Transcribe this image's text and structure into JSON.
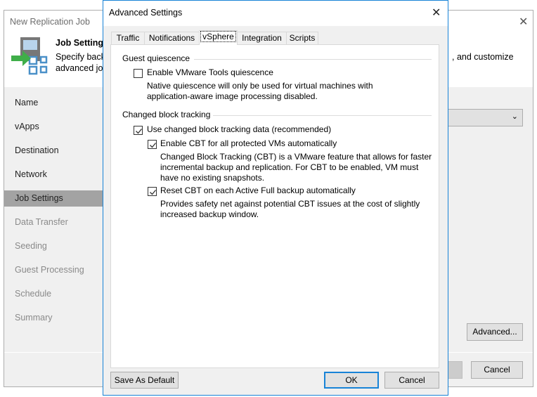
{
  "main_window": {
    "title": "New Replication Job",
    "header_title": "Job Settings",
    "header_desc_line1": "Specify back",
    "header_desc_line2": "advanced job",
    "header_desc_right": ", and customize",
    "sidebar": [
      {
        "label": "Name",
        "state": "normal"
      },
      {
        "label": "vApps",
        "state": "normal"
      },
      {
        "label": "Destination",
        "state": "normal"
      },
      {
        "label": "Network",
        "state": "normal"
      },
      {
        "label": "Job Settings",
        "state": "selected"
      },
      {
        "label": "Data Transfer",
        "state": "disabled"
      },
      {
        "label": "Seeding",
        "state": "disabled"
      },
      {
        "label": "Guest Processing",
        "state": "disabled"
      },
      {
        "label": "Schedule",
        "state": "disabled"
      },
      {
        "label": "Summary",
        "state": "disabled"
      }
    ],
    "advanced_button": "Advanced...",
    "cancel_button": "Cancel"
  },
  "dialog": {
    "title": "Advanced Settings",
    "tabs": [
      "Traffic",
      "Notifications",
      "vSphere",
      "Integration",
      "Scripts"
    ],
    "active_tab": "vSphere",
    "guest_quiescence": {
      "heading": "Guest quiescence",
      "vmware_tools_label": "Enable VMware Tools quiescence",
      "vmware_tools_checked": false,
      "desc_line1": "Native quiescence will only be used for virtual machines with",
      "desc_line2": "application-aware image processing disabled."
    },
    "cbt": {
      "heading": "Changed block tracking",
      "use_cbt_label": "Use changed block tracking data (recommended)",
      "use_cbt_checked": true,
      "enable_cbt_label": "Enable CBT for all protected VMs automatically",
      "enable_cbt_checked": true,
      "enable_desc_line1": "Changed Block Tracking (CBT) is a VMware feature that allows for faster",
      "enable_desc_line2": "incremental backup and replication. For CBT to be enabled, VM must",
      "enable_desc_line3": "have no existing snapshots.",
      "reset_cbt_label": "Reset CBT on each Active Full backup automatically",
      "reset_cbt_checked": true,
      "reset_desc_line1": "Provides safety net against potential CBT issues at the cost of slightly",
      "reset_desc_line2": "increased backup window."
    },
    "save_default_button": "Save As Default",
    "ok_button": "OK",
    "cancel_button": "Cancel"
  },
  "colors": {
    "accent": "#1883d7",
    "selected_nav": "#a3a3a3",
    "icon_green": "#3fae49",
    "icon_blue": "#4a90c8"
  }
}
